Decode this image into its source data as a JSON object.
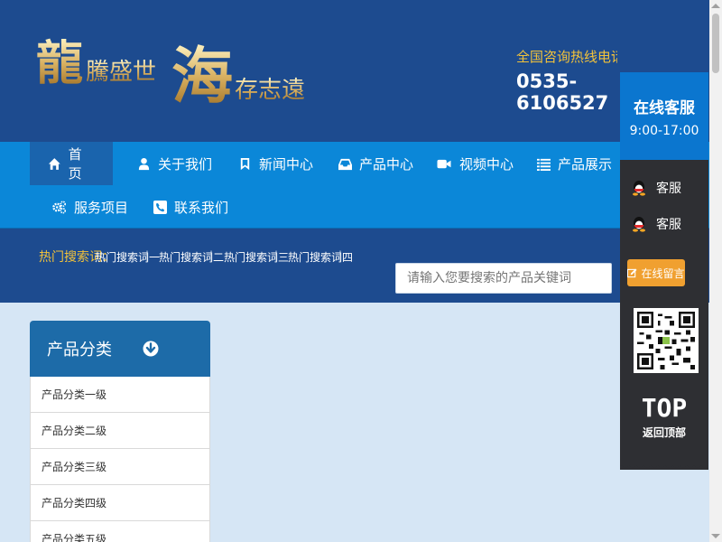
{
  "header": {
    "logo_text": "龍騰盛世 海存志遠",
    "hotline_label": "全国咨询热线电话号码：",
    "phone": "0535-6106527"
  },
  "nav": {
    "items": [
      {
        "label": "首页",
        "icon": "home-icon"
      },
      {
        "label": "关于我们",
        "icon": "user-icon"
      },
      {
        "label": "新闻中心",
        "icon": "bookmark-icon"
      },
      {
        "label": "产品中心",
        "icon": "inbox-icon"
      },
      {
        "label": "视频中心",
        "icon": "video-icon"
      },
      {
        "label": "产品展示",
        "icon": "list-icon"
      },
      {
        "label": "服务项目",
        "icon": "gears-icon"
      },
      {
        "label": "联系我们",
        "icon": "phone-icon"
      }
    ]
  },
  "hotwords": {
    "title": "热门搜索词：",
    "items": [
      "热门搜索词一",
      "热门搜索词二",
      "热门搜索词三",
      "热门搜索词四"
    ]
  },
  "search": {
    "placeholder": "请输入您要搜索的产品关键词"
  },
  "categories": {
    "title": "产品分类",
    "items": [
      "产品分类一级",
      "产品分类二级",
      "产品分类三级",
      "产品分类四级",
      "产品分类五级"
    ]
  },
  "kefu": {
    "title": "在线客服",
    "time": "9:00-17:00",
    "qq1": "客服",
    "qq2": "客服",
    "message": "在线留言",
    "top": "TOP",
    "top_sub": "返回顶部"
  },
  "colors": {
    "header_bg": "#1d4b8f",
    "nav_bg": "#0b87d8",
    "accent_gold": "#f2c23a",
    "kefu_blue": "#0b76cf"
  }
}
